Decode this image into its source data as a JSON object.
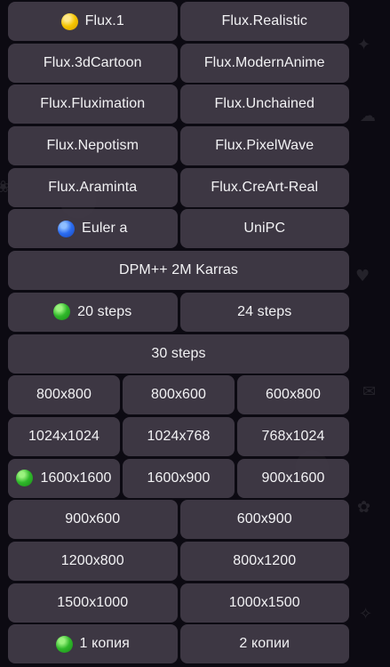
{
  "colors": {
    "background": "#0c0a12",
    "button": "#443e4a",
    "text": "#f2f2f4",
    "yellow_dot": "#f5c400",
    "blue_dot": "#2b6cf0",
    "green_dot": "#2fb82a"
  },
  "keyboard": {
    "rows": [
      [
        {
          "label": "Flux.1",
          "dot": "yellow"
        },
        {
          "label": "Flux.Realistic"
        }
      ],
      [
        {
          "label": "Flux.3dCartoon"
        },
        {
          "label": "Flux.ModernAnime"
        }
      ],
      [
        {
          "label": "Flux.Fluximation"
        },
        {
          "label": "Flux.Unchained"
        }
      ],
      [
        {
          "label": "Flux.Nepotism"
        },
        {
          "label": "Flux.PixelWave"
        }
      ],
      [
        {
          "label": "Flux.Araminta"
        },
        {
          "label": "Flux.CreArt-Real"
        }
      ],
      [
        {
          "label": "Euler a",
          "dot": "blue"
        },
        {
          "label": "UniPC"
        }
      ],
      [
        {
          "label": "DPM++ 2M Karras"
        }
      ],
      [
        {
          "label": "20 steps",
          "dot": "green"
        },
        {
          "label": "24 steps"
        }
      ],
      [
        {
          "label": "30 steps"
        }
      ],
      [
        {
          "label": "800x800"
        },
        {
          "label": "800x600"
        },
        {
          "label": "600x800"
        }
      ],
      [
        {
          "label": "1024x1024"
        },
        {
          "label": "1024x768"
        },
        {
          "label": "768x1024"
        }
      ],
      [
        {
          "label": "1600x1600",
          "dot": "green"
        },
        {
          "label": "1600x900"
        },
        {
          "label": "900x1600"
        }
      ],
      [
        {
          "label": "900x600"
        },
        {
          "label": "600x900"
        }
      ],
      [
        {
          "label": "1200x800"
        },
        {
          "label": "800x1200"
        }
      ],
      [
        {
          "label": "1500x1000"
        },
        {
          "label": "1000x1500"
        }
      ],
      [
        {
          "label": "1 копия",
          "dot": "green"
        },
        {
          "label": "2 копии"
        }
      ]
    ]
  }
}
